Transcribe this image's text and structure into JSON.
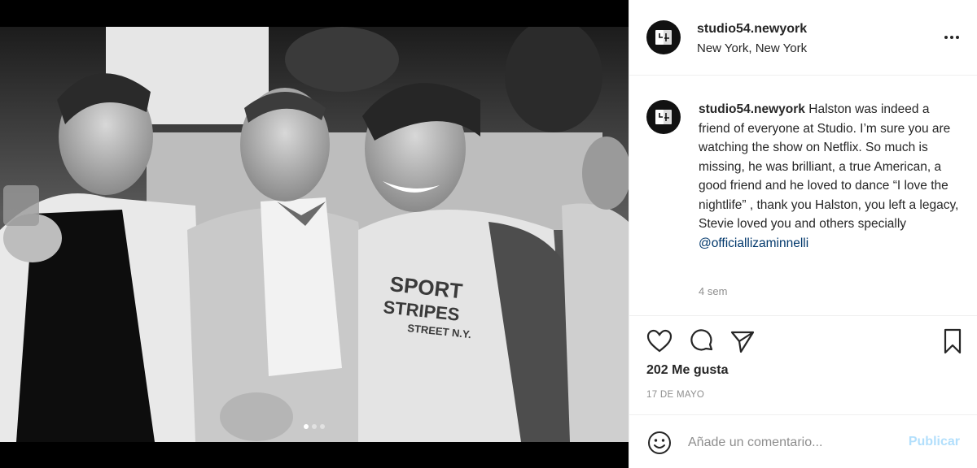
{
  "post": {
    "username": "studio54.newyork",
    "location": "New York, New York",
    "more_icon": "more-horizontal-icon"
  },
  "caption": {
    "username": "studio54.newyork",
    "text": "Halston was indeed a friend of everyone at Studio. I’m sure you are watching the show on Netflix. So much is missing, he was brilliant, a true American, a good friend and he loved to dance “I love the nightlife” , thank you Halston, you left a legacy, Stevie loved you and others specially",
    "mention": "@officiallizaminnelli",
    "time_ago": "4 sem"
  },
  "photo": {
    "shirt_text_line1": "SPORT",
    "shirt_text_line2": "STRIPES",
    "shirt_text_line3": "STREET N.Y.",
    "carousel": {
      "count": 3,
      "active": 1
    }
  },
  "actions": {
    "icons": [
      "heart-icon",
      "comment-icon",
      "share-icon",
      "bookmark-icon"
    ],
    "likes": "202 Me gusta",
    "date": "17 DE MAYO"
  },
  "add_comment": {
    "placeholder": "Añade un comentario...",
    "post_label": "Publicar",
    "emoji_icon": "emoji-icon"
  },
  "colors": {
    "text": "#262626",
    "secondary": "#8e8e8e",
    "mention": "#00376b",
    "publish_disabled": "#b2dffc",
    "border": "#efefef"
  }
}
